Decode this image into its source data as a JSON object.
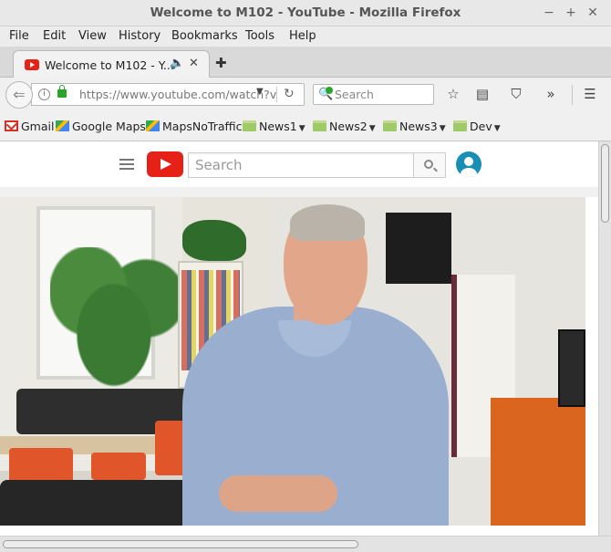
{
  "window": {
    "title": "Welcome to M102 - YouTube - Mozilla Firefox",
    "minimize": "−",
    "maximize": "+",
    "close": "✕"
  },
  "menu": [
    "File",
    "Edit",
    "View",
    "History",
    "Bookmarks",
    "Tools",
    "Help"
  ],
  "tab": {
    "title": "Welcome to M102 - Y...",
    "audio_icon": "speaker-icon",
    "close": "✕",
    "new_tab": "✚"
  },
  "navbar": {
    "url": "https://www.youtube.com/watch?v",
    "search_placeholder": "Search",
    "icons": [
      "back-icon",
      "info-icon",
      "lock-icon",
      "dropdown-icon",
      "reload-icon",
      "bookmark-star-icon",
      "reading-list-icon",
      "pocket-icon",
      "overflow-icon",
      "hamburger-menu-icon"
    ]
  },
  "bookmarks": [
    {
      "label": "Gmail",
      "icon": "gmail-icon",
      "folder": false
    },
    {
      "label": "Google Maps",
      "icon": "maps-icon",
      "folder": false
    },
    {
      "label": "MapsNoTraffic",
      "icon": "maps-icon",
      "folder": false
    },
    {
      "label": "News1",
      "icon": "folder-icon",
      "folder": true
    },
    {
      "label": "News2",
      "icon": "folder-icon",
      "folder": true
    },
    {
      "label": "News3",
      "icon": "folder-icon",
      "folder": true
    },
    {
      "label": "Dev",
      "icon": "folder-icon",
      "folder": true
    }
  ],
  "youtube": {
    "search_placeholder": "Search"
  },
  "colors": {
    "youtube_red": "#e62117",
    "avatar_blue": "#1a8fb4",
    "secure_green": "#2aa52a"
  }
}
